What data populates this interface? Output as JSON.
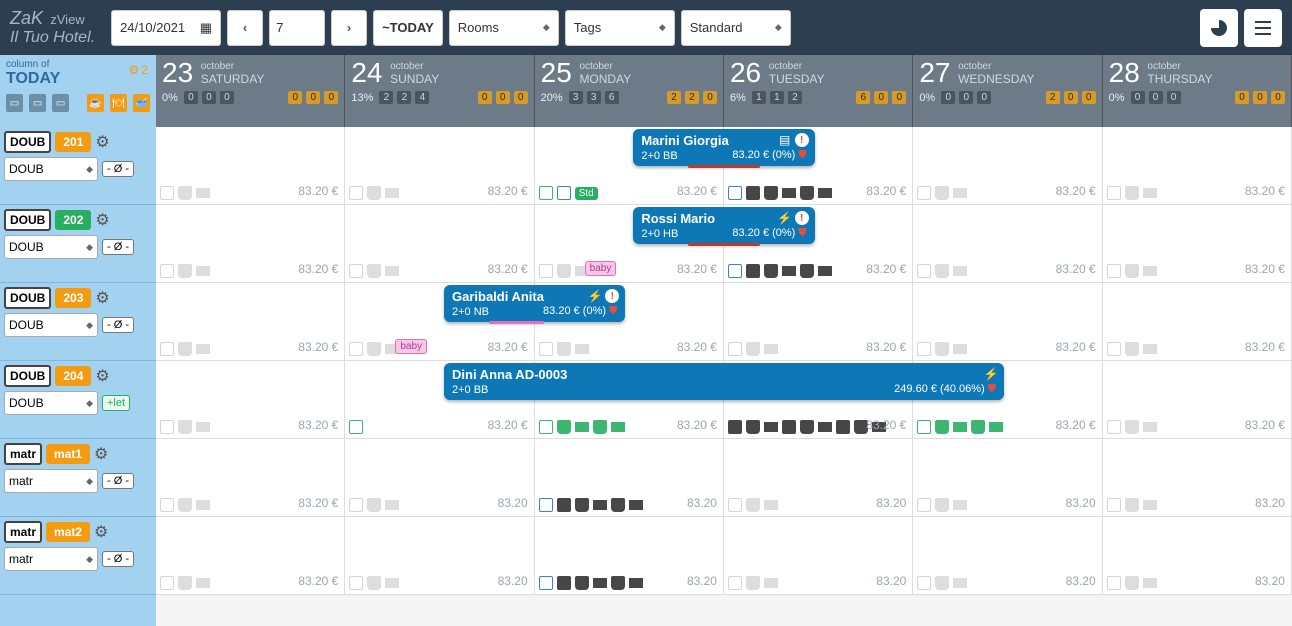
{
  "header": {
    "logo": "ZaK",
    "app_name": "zView",
    "hotel_name": "Il Tuo Hotel.",
    "date": "24/10/2021",
    "days": "7",
    "today_btn": "~TODAY",
    "selects": {
      "rooms": "Rooms",
      "tags": "Tags",
      "standard": "Standard"
    }
  },
  "sidebar": {
    "column_label": "column of",
    "today": "TODAY",
    "gear_count": "2"
  },
  "days": [
    {
      "num": "23",
      "month": "october",
      "weekday": "SATURDAY",
      "pct": "0%",
      "c1": [
        "0",
        "0",
        "0"
      ],
      "c2": [
        "0",
        "0",
        "0"
      ]
    },
    {
      "num": "24",
      "month": "october",
      "weekday": "SUNDAY",
      "pct": "13%",
      "c1": [
        "2",
        "2",
        "4"
      ],
      "c2": [
        "0",
        "0",
        "0"
      ]
    },
    {
      "num": "25",
      "month": "october",
      "weekday": "MONDAY",
      "pct": "20%",
      "c1": [
        "3",
        "3",
        "6"
      ],
      "c2": [
        "2",
        "2",
        "0"
      ]
    },
    {
      "num": "26",
      "month": "october",
      "weekday": "TUESDAY",
      "pct": "6%",
      "c1": [
        "1",
        "1",
        "2"
      ],
      "c2": [
        "6",
        "0",
        "0"
      ]
    },
    {
      "num": "27",
      "month": "october",
      "weekday": "WEDNESDAY",
      "pct": "0%",
      "c1": [
        "0",
        "0",
        "0"
      ],
      "c2": [
        "2",
        "0",
        "0"
      ]
    },
    {
      "num": "28",
      "month": "october",
      "weekday": "THURSDAY",
      "pct": "0%",
      "c1": [
        "0",
        "0",
        "0"
      ],
      "c2": [
        "0",
        "0",
        "0"
      ]
    }
  ],
  "rooms": [
    {
      "type": "DOUB",
      "num": "201",
      "numClass": "",
      "sel": "DOUB",
      "extra": "- Ø -",
      "extraClass": ""
    },
    {
      "type": "DOUB",
      "num": "202",
      "numClass": "green",
      "sel": "DOUB",
      "extra": "- Ø -",
      "extraClass": ""
    },
    {
      "type": "DOUB",
      "num": "203",
      "numClass": "",
      "sel": "DOUB",
      "extra": "- Ø -",
      "extraClass": ""
    },
    {
      "type": "DOUB",
      "num": "204",
      "numClass": "",
      "sel": "DOUB",
      "extra": "+let",
      "extraClass": "green"
    },
    {
      "type": "matr",
      "num": "mat1",
      "numClass": "",
      "sel": "matr",
      "extra": "- Ø -",
      "extraClass": ""
    },
    {
      "type": "matr",
      "num": "mat2",
      "numClass": "",
      "sel": "matr",
      "extra": "- Ø -",
      "extraClass": ""
    }
  ],
  "default_price": "83.20 €",
  "price_row6": "83.20",
  "bookings": {
    "b1": {
      "name": "Marini Giorgia",
      "sub": "2+0 BB",
      "price": "83.20 € (0%)"
    },
    "b2": {
      "name": "Rossi Mario",
      "sub": "2+0 HB",
      "price": "83.20 € (0%)"
    },
    "b3": {
      "name": "Garibaldi Anita",
      "sub": "2+0 NB",
      "price": "83.20 € (0%)"
    },
    "b4": {
      "name": "Dini Anna AD-0003",
      "sub": "2+0 BB",
      "price": "249.60 € (40.06%)"
    }
  },
  "tags": {
    "std": "Std",
    "baby": "baby"
  }
}
